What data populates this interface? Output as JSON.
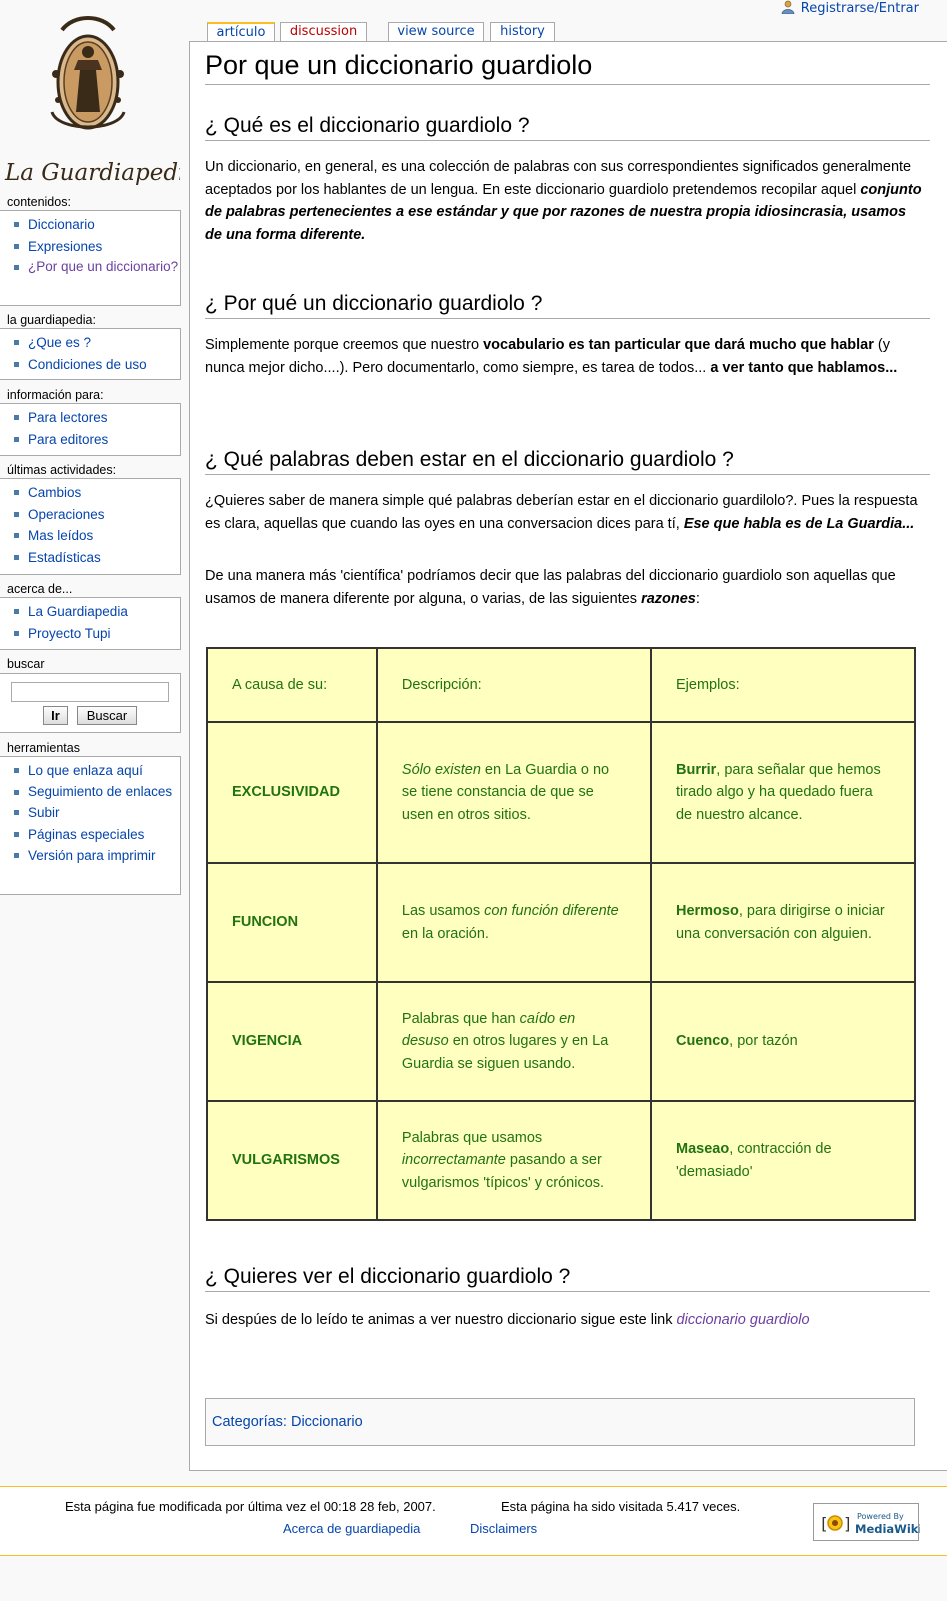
{
  "personal_tools": {
    "login_label": "Registrarse/Entrar"
  },
  "logo": {
    "text": "La Guardiapedia"
  },
  "tabs": [
    {
      "label": "artículo"
    },
    {
      "label": "discussion"
    },
    {
      "label": "view source"
    },
    {
      "label": "history"
    }
  ],
  "page": {
    "title": "Por que un diccionario guardiolo",
    "sections": [
      {
        "heading": "¿ Qué es el diccionario guardiolo ?",
        "p1_plain": "Un diccionario, en general, es una colección de palabras con sus correspondientes significados generalmente aceptados por los hablantes de un lengua. En este diccionario guardiolo pretendemos recopilar aquel ",
        "p1_emph": "conjunto de palabras pertenecientes a ese estándar y que por razones de nuestra propia idiosincrasia, usamos de una forma diferente."
      },
      {
        "heading": "¿ Por qué un diccionario guardiolo ?",
        "p1_a": "Simplemente porque creemos que nuestro ",
        "p1_b": "vocabulario es tan particular que dará mucho que hablar",
        "p1_c": " (y nunca mejor dicho....). Pero documentarlo, como siempre, es tarea de todos... ",
        "p1_d": "a ver tanto que hablamos..."
      },
      {
        "heading": "¿ Qué palabras deben estar en el diccionario guardiolo ?",
        "p1_a": "¿Quieres saber de manera simple qué palabras deberían estar en el diccionario guardilolo?. Pues la respuesta es clara, aquellas que cuando las oyes en una conversacion dices para tí, ",
        "p1_b": "Ese que habla es de La Guardia...",
        "p2_a": "De una manera más 'científica' podríamos decir que las palabras del diccionario guardiolo son aquellas que usamos de manera diferente por alguna, o varias, de las siguientes ",
        "p2_b": "razones",
        "p2_c": ":"
      },
      {
        "heading": "¿ Quieres ver el diccionario guardiolo ?",
        "p1_a": "Si despúes de lo leído te animas a ver nuestro diccionario sigue este link ",
        "p1_link": "diccionario guardiolo"
      }
    ],
    "table": {
      "headers": [
        "A causa de su:",
        "Descripción:",
        "Ejemplos:"
      ],
      "rows": [
        {
          "cause": "EXCLUSIVIDAD",
          "desc": [
            [
              "Sólo existen",
              true
            ],
            [
              " en La Guardia o no se tiene constancia de que se usen en otros sitios.",
              false
            ]
          ],
          "ex_word": "Burrir",
          "ex_text": ", para señalar que hemos tirado algo y ha quedado fuera de nuestro alcance."
        },
        {
          "cause": "FUNCION",
          "desc": [
            [
              "Las usamos ",
              false
            ],
            [
              "con función diferente",
              true
            ],
            [
              " en la oración.",
              false
            ]
          ],
          "ex_word": "Hermoso",
          "ex_text": ", para dirigirse o iniciar una conversación con alguien."
        },
        {
          "cause": "VIGENCIA",
          "desc": [
            [
              "Palabras que han ",
              false
            ],
            [
              "caído en desuso",
              true
            ],
            [
              " en otros lugares y en La Guardia se siguen usando.",
              false
            ]
          ],
          "ex_word": "Cuenco",
          "ex_text": ", por tazón"
        },
        {
          "cause": "VULGARISMOS",
          "desc": [
            [
              "Palabras que usamos ",
              false
            ],
            [
              "incorrectamante",
              true
            ],
            [
              " pasando a ser vulgarismos 'típicos' y crónicos.",
              false
            ]
          ],
          "ex_word": "Maseao",
          "ex_text": ", contracción de 'demasiado'"
        }
      ]
    },
    "categories": "Categorías: Diccionario"
  },
  "sidebar": {
    "navigation": {
      "title": "contenidos:",
      "items": [
        "Diccionario",
        "Expresiones",
        "¿Por que un diccionario?"
      ]
    },
    "guardiapedia": {
      "title": "la guardiapedia:",
      "items": [
        "¿Que es ?",
        "Condiciones de uso"
      ]
    },
    "info": {
      "title": "información para:",
      "items": [
        "Para lectores",
        "Para editores"
      ]
    },
    "recent": {
      "title": "últimas actividades:",
      "items": [
        "Cambios",
        "Operaciones",
        "Mas leídos",
        "Estadísticas"
      ]
    },
    "about": {
      "title": "acerca de...",
      "items": [
        "La Guardiapedia",
        "Proyecto Tupi"
      ]
    },
    "search": {
      "title": "buscar",
      "go": "Ir",
      "search": "Buscar"
    },
    "tools": {
      "title": "herramientas",
      "items": [
        "Lo que enlaza aquí",
        "Seguimiento de enlaces",
        "Subir",
        "Páginas especiales",
        "Versión para imprimir"
      ]
    }
  },
  "footer": {
    "lastmod": "Esta página fue modificada por última vez el 00:18 28 feb, 2007.",
    "viewcount": "Esta página ha sido visitada 5.417 veces.",
    "about": "Acerca de guardiapedia",
    "disclaimers": "Disclaimers",
    "powered_line1": "Powered By",
    "powered_line2": "MediaWiki"
  }
}
